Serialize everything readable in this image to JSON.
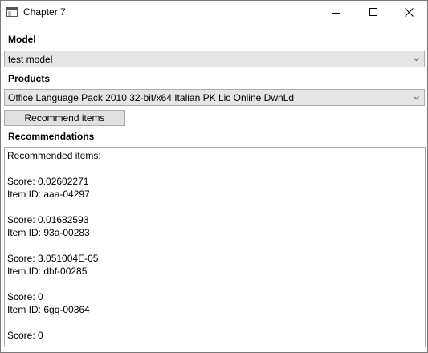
{
  "window": {
    "title": "Chapter 7"
  },
  "model": {
    "label": "Model",
    "selected": "test model"
  },
  "products": {
    "label": "Products",
    "selected": "Office Language Pack 2010 32-bit/x64 Italian PK Lic Online DwnLd"
  },
  "actions": {
    "recommend_label": "Recommend items"
  },
  "recommendations": {
    "label": "Recommendations",
    "heading": "Recommended items:",
    "items": [
      {
        "score": "Score: 0.02602271",
        "item_id": "Item ID: aaa-04297"
      },
      {
        "score": "Score: 0.01682593",
        "item_id": "Item ID: 93a-00283"
      },
      {
        "score": "Score: 3.051004E-05",
        "item_id": "Item ID: dhf-00285"
      },
      {
        "score": "Score: 0",
        "item_id": "Item ID: 6gq-00364"
      },
      {
        "score": "Score: 0"
      }
    ]
  },
  "icons": {
    "app": "app-window-icon",
    "minimize": "minimize-icon",
    "maximize": "maximize-icon",
    "close": "close-icon",
    "dropdown": "chevron-down-icon"
  }
}
